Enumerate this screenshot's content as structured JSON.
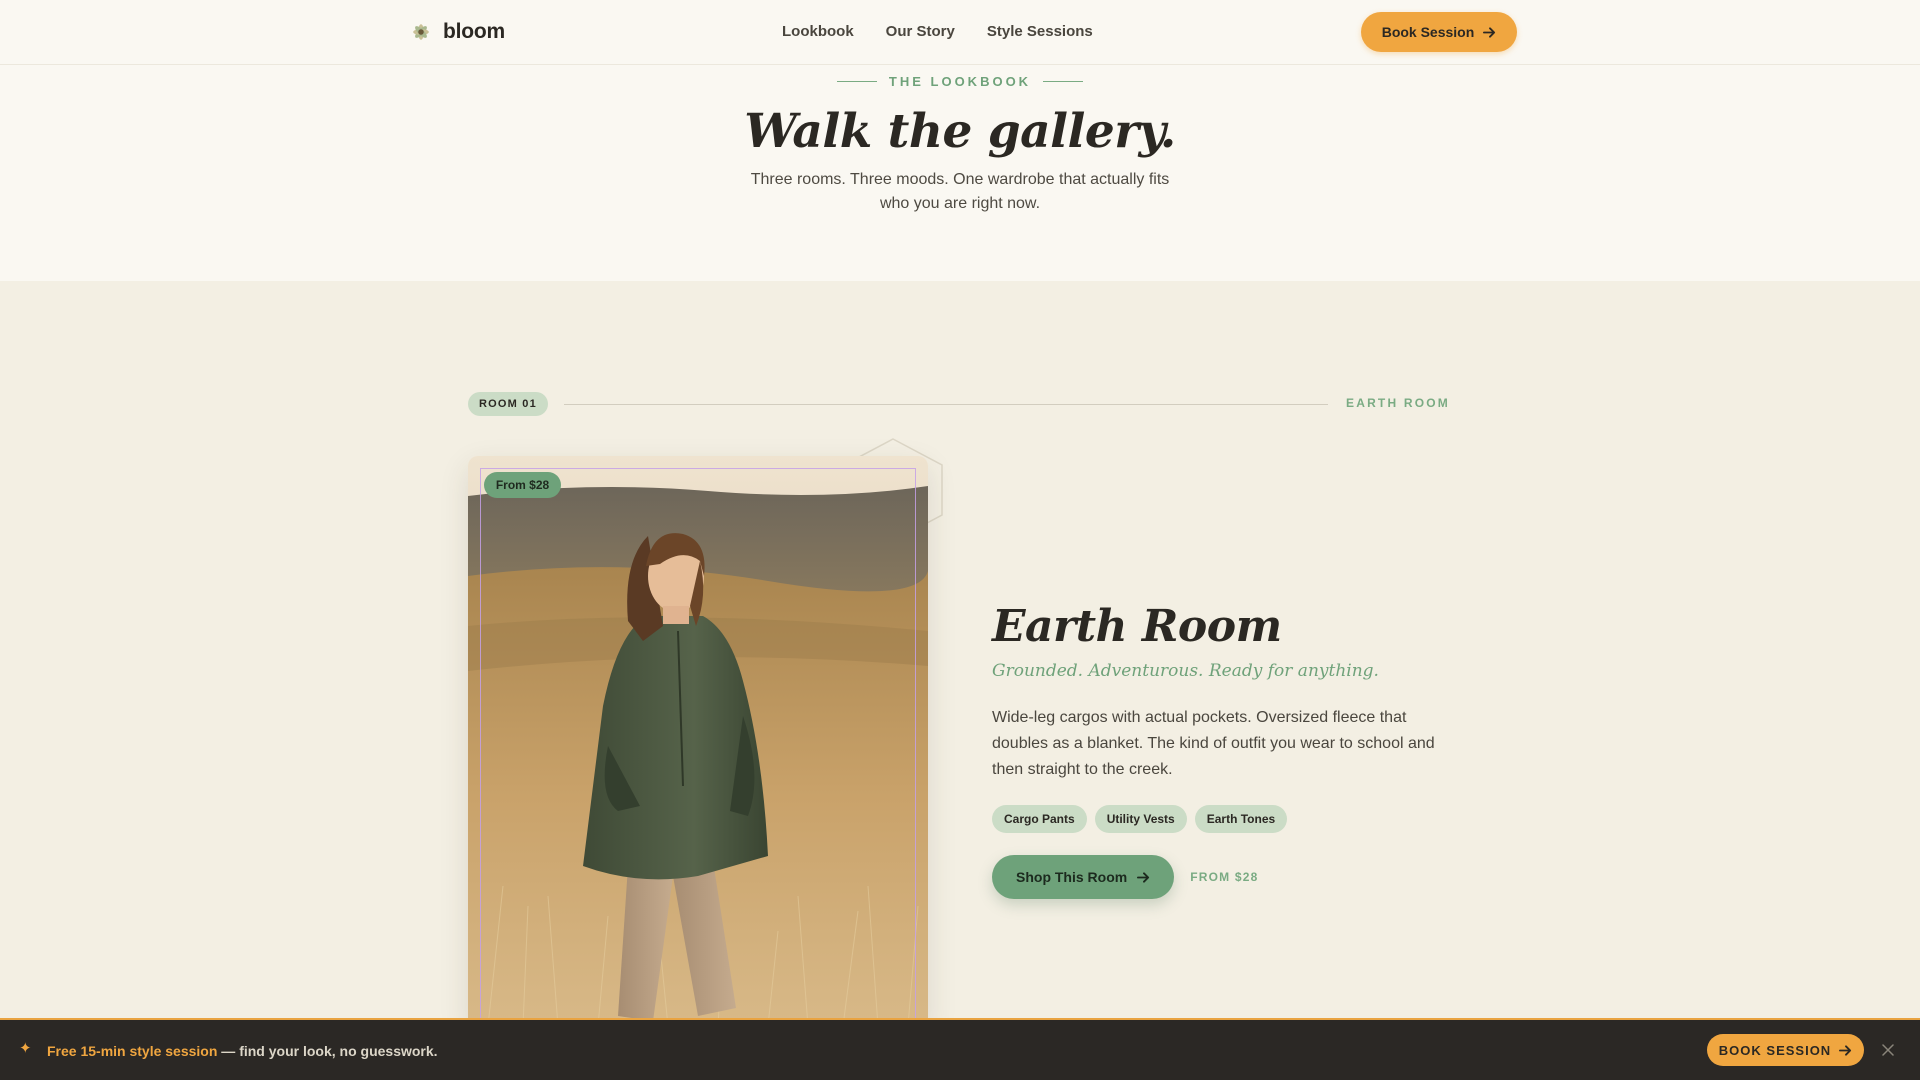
{
  "header": {
    "logo_text": "bloom",
    "logo_icon": "flower-icon",
    "nav": [
      "Lookbook",
      "Our Story",
      "Style Sessions"
    ],
    "book_label": "Book Session"
  },
  "hero": {
    "eyebrow": "THE LOOKBOOK",
    "title": "Walk the gallery.",
    "subtitle": "Three rooms. Three moods. One wardrobe that actually fits who you are right now."
  },
  "room": {
    "badge": "ROOM 01",
    "label": "EARTH ROOM",
    "price_badge": "From $28",
    "title": "Earth Room",
    "tagline": "Grounded. Adventurous. Ready for anything.",
    "description": "Wide-leg cargos with actual pockets. Oversized fleece that doubles as a blanket. The kind of outfit you wear to school and then straight to the creek.",
    "tags": [
      "Cargo Pants",
      "Utility Vests",
      "Earth Tones"
    ],
    "cta_label": "Shop This Room",
    "cta_price": "FROM $28"
  },
  "promo": {
    "highlight": "Free 15-min style session",
    "rest": " — find your look, no guesswork.",
    "button_label": "BOOK SESSION"
  },
  "colors": {
    "accent_orange": "#f0a640",
    "sage_green": "#6ea27a",
    "cream_bg": "#faf8f2",
    "section_bg": "#f3efe3",
    "dark_bar": "#2b2825"
  }
}
